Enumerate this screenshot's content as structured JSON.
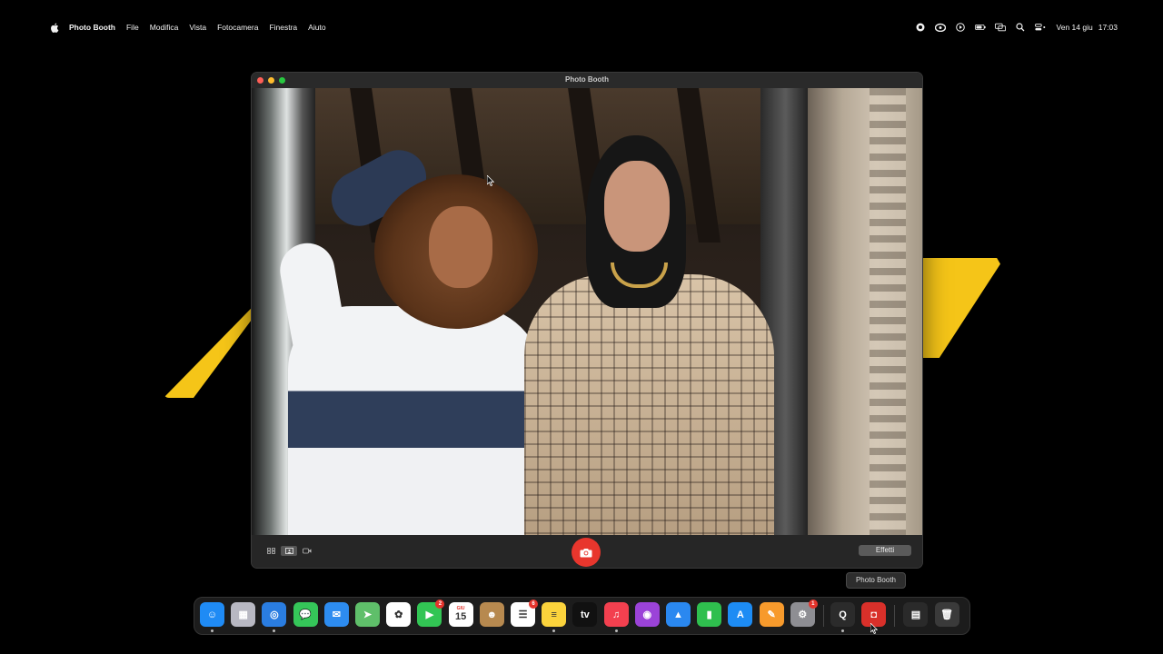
{
  "menubar": {
    "app_name": "Photo Booth",
    "menus": [
      "File",
      "Modifica",
      "Vista",
      "Fotocamera",
      "Finestra",
      "Aiuto"
    ],
    "date": "Ven 14 giu",
    "time": "17:03"
  },
  "window": {
    "title": "Photo Booth",
    "effects_label": "Effetti"
  },
  "tooltip": "Photo Booth",
  "dock": {
    "items": [
      {
        "name": "finder",
        "glyph": "☺",
        "bg": "#1f8bf5",
        "running": true
      },
      {
        "name": "launchpad",
        "glyph": "▦",
        "bg": "#b8b8c2",
        "running": false
      },
      {
        "name": "safari",
        "glyph": "◎",
        "bg": "#2a7de1",
        "running": true
      },
      {
        "name": "messages",
        "glyph": "💬",
        "bg": "#35c659",
        "running": false
      },
      {
        "name": "mail",
        "glyph": "✉",
        "bg": "#2d8cf0",
        "running": false
      },
      {
        "name": "maps",
        "glyph": "➤",
        "bg": "#5fbf6a",
        "running": false
      },
      {
        "name": "photos",
        "glyph": "✿",
        "bg": "#ffffff",
        "running": false
      },
      {
        "name": "facetime",
        "glyph": "▶",
        "bg": "#32c554",
        "running": false,
        "badge": "2"
      },
      {
        "name": "calendar",
        "glyph": "15",
        "bg": "#ffffff",
        "running": false,
        "month": "GIU"
      },
      {
        "name": "contacts",
        "glyph": "☻",
        "bg": "#b7894f",
        "running": false
      },
      {
        "name": "reminders",
        "glyph": "☰",
        "bg": "#ffffff",
        "running": false,
        "badge": "6"
      },
      {
        "name": "notes",
        "glyph": "≡",
        "bg": "#fbd33c",
        "running": true
      },
      {
        "name": "tv",
        "glyph": "tv",
        "bg": "#111111",
        "running": false
      },
      {
        "name": "music",
        "glyph": "♫",
        "bg": "#f3404f",
        "running": true
      },
      {
        "name": "podcasts",
        "glyph": "◉",
        "bg": "#9b43d8",
        "running": false
      },
      {
        "name": "keynote",
        "glyph": "▲",
        "bg": "#2a88f0",
        "running": false
      },
      {
        "name": "numbers",
        "glyph": "▮",
        "bg": "#2fbf4e",
        "running": false
      },
      {
        "name": "app-store",
        "glyph": "A",
        "bg": "#1d8cf4",
        "running": false
      },
      {
        "name": "pages",
        "glyph": "✎",
        "bg": "#f79a2c",
        "running": false
      },
      {
        "name": "system-settings",
        "glyph": "⚙",
        "bg": "#8e8e93",
        "running": false,
        "badge": "1"
      },
      {
        "name": "quicktime",
        "glyph": "Q",
        "bg": "#2b2b2b",
        "running": true
      },
      {
        "name": "photo-booth",
        "glyph": "◘",
        "bg": "#d9302a",
        "running": true
      },
      {
        "name": "downloads-stack",
        "glyph": "▤",
        "bg": "#2a2a2a",
        "running": false
      },
      {
        "name": "trash",
        "glyph": "🗑",
        "bg": "#3a3a3a",
        "running": false
      }
    ]
  }
}
